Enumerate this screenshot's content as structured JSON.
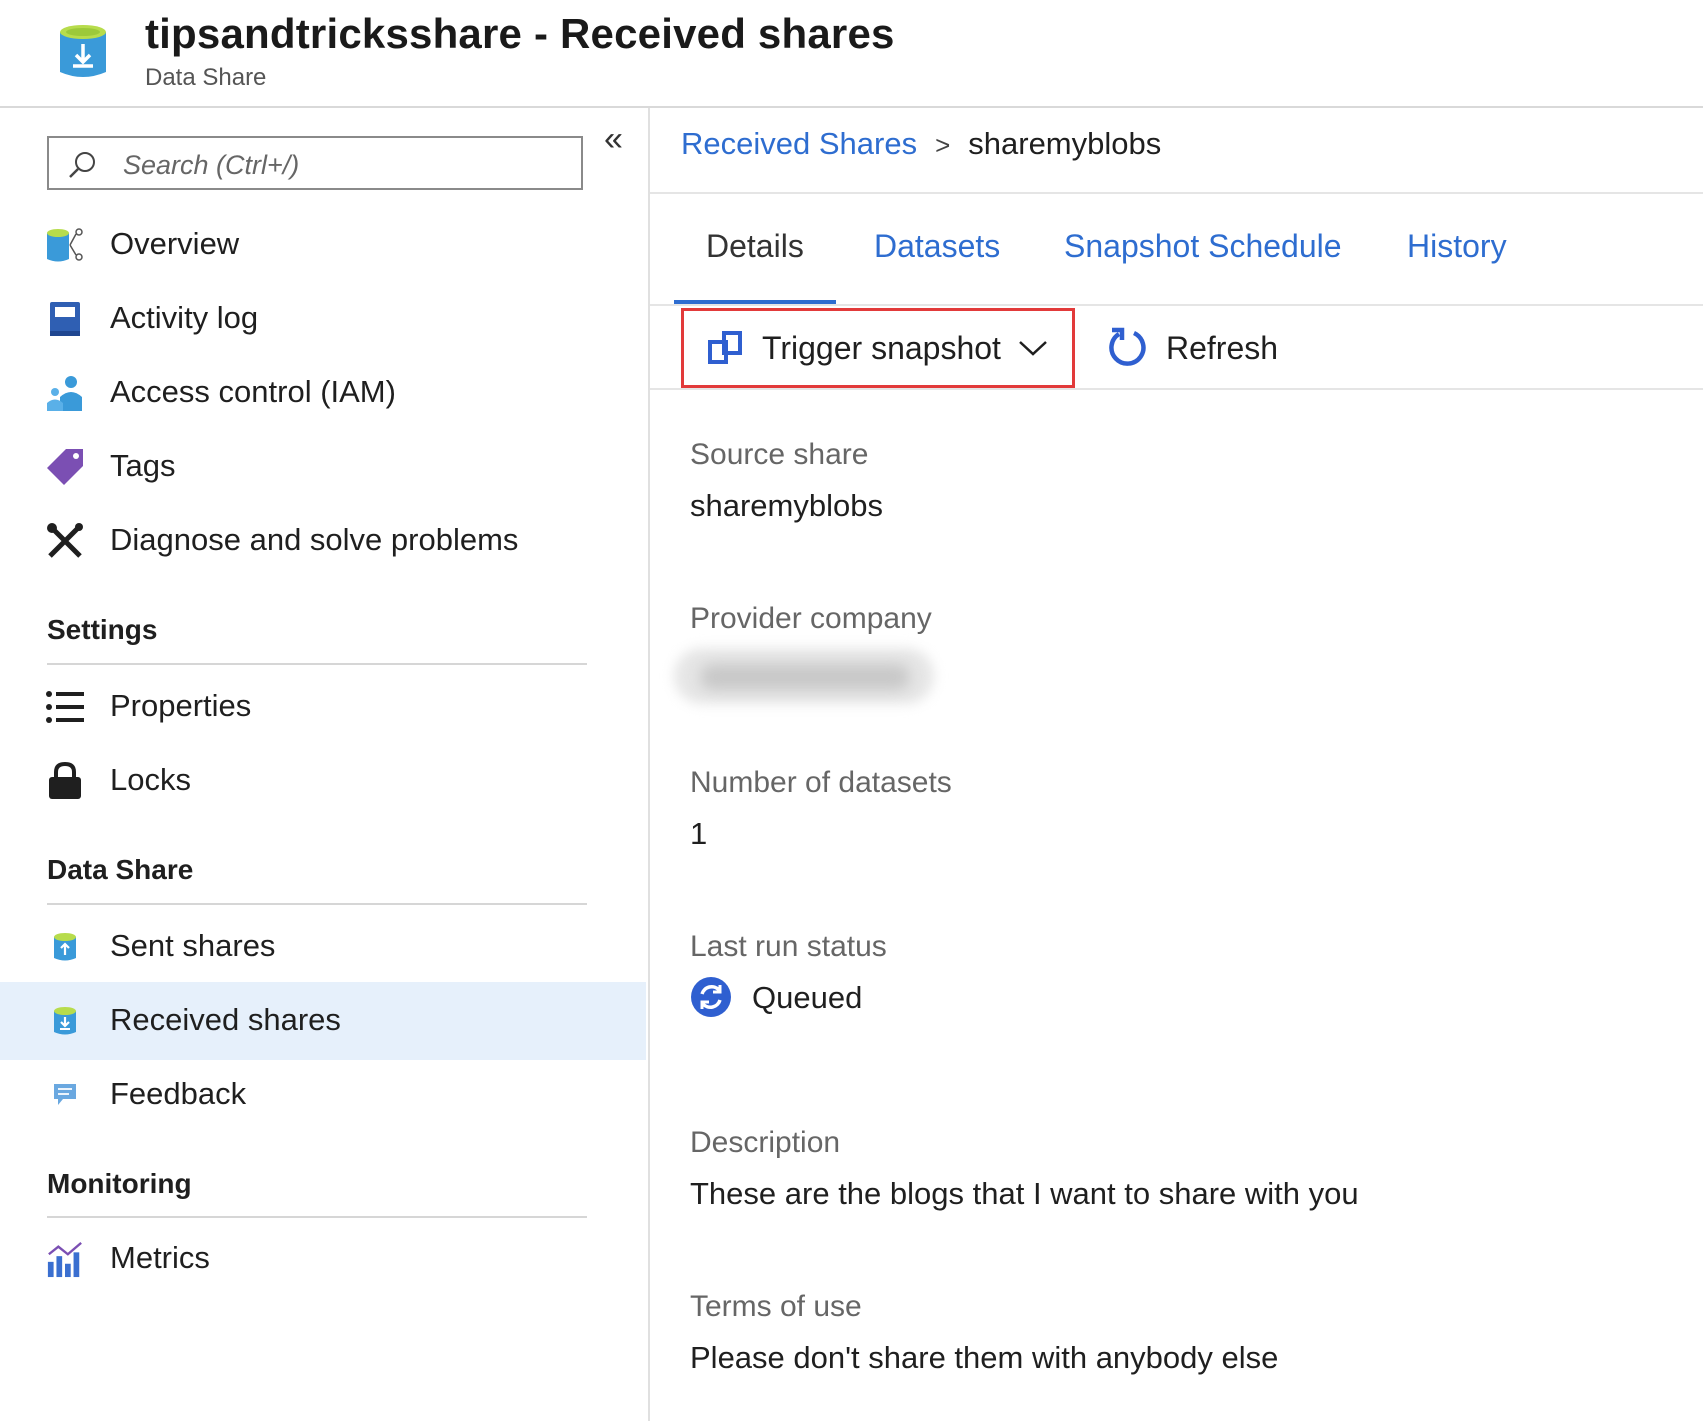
{
  "header": {
    "title": "tipsandtricksshare - Received shares",
    "subtitle": "Data Share",
    "icon": "data-share-received-icon"
  },
  "sidebar": {
    "search_placeholder": "Search (Ctrl+/)",
    "collapse_label": "«",
    "items": [
      {
        "label": "Overview",
        "icon": "overview-icon"
      },
      {
        "label": "Activity log",
        "icon": "activity-log-icon"
      },
      {
        "label": "Access control (IAM)",
        "icon": "iam-icon"
      },
      {
        "label": "Tags",
        "icon": "tag-icon"
      },
      {
        "label": "Diagnose and solve problems",
        "icon": "wrench-icon"
      }
    ],
    "sections": [
      {
        "header": "Settings",
        "items": [
          {
            "label": "Properties",
            "icon": "list-icon"
          },
          {
            "label": "Locks",
            "icon": "lock-icon"
          }
        ]
      },
      {
        "header": "Data Share",
        "items": [
          {
            "label": "Sent shares",
            "icon": "sent-shares-icon"
          },
          {
            "label": "Received shares",
            "icon": "received-shares-icon",
            "selected": true
          },
          {
            "label": "Feedback",
            "icon": "feedback-icon"
          }
        ]
      },
      {
        "header": "Monitoring",
        "items": [
          {
            "label": "Metrics",
            "icon": "metrics-icon"
          }
        ]
      }
    ]
  },
  "main": {
    "breadcrumb": {
      "parent": "Received Shares",
      "separator": ">",
      "current": "sharemyblobs"
    },
    "tabs": [
      {
        "label": "Details",
        "active": true
      },
      {
        "label": "Datasets"
      },
      {
        "label": "Snapshot Schedule"
      },
      {
        "label": "History"
      }
    ],
    "toolbar": {
      "trigger_label": "Trigger snapshot",
      "refresh_label": "Refresh"
    },
    "fields": {
      "source_share": {
        "label": "Source share",
        "value": "sharemyblobs"
      },
      "provider_company": {
        "label": "Provider company"
      },
      "num_datasets": {
        "label": "Number of datasets",
        "value": "1"
      },
      "last_run_status": {
        "label": "Last run status",
        "value": "Queued"
      },
      "description": {
        "label": "Description",
        "value": "These are the blogs that I want to share with you"
      },
      "terms": {
        "label": "Terms of use",
        "value": "Please don't share them with anybody else"
      }
    }
  },
  "colors": {
    "accent": "#2e6dd0",
    "highlight_box": "#e23a3a",
    "selected_bg": "#e6f0fb"
  }
}
